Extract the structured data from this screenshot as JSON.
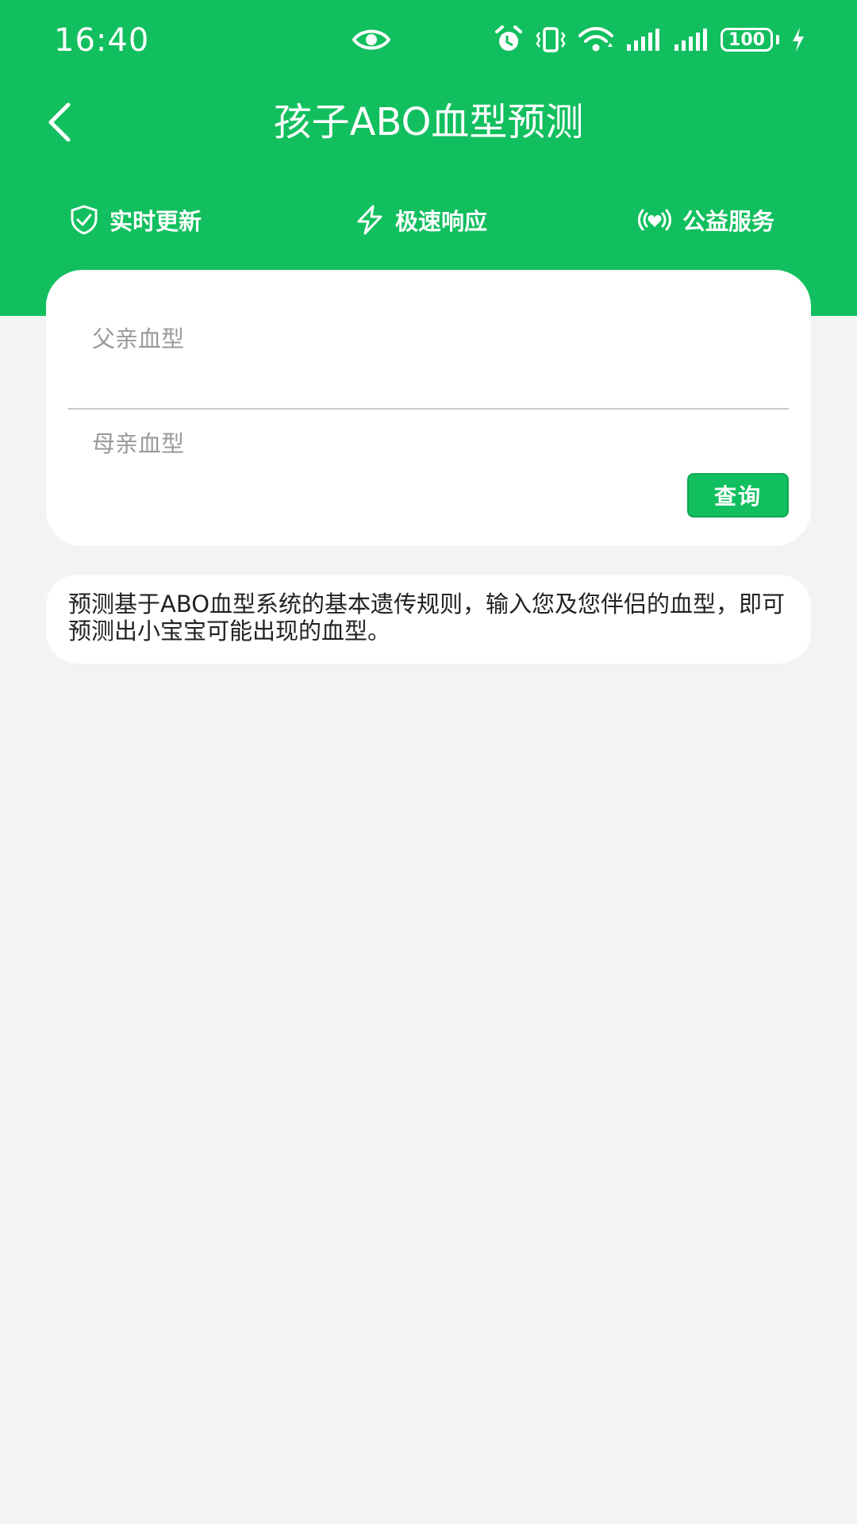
{
  "status_bar": {
    "time": "16:40",
    "battery": "100",
    "icons": [
      "eye-icon",
      "alarm-icon",
      "vibrate-icon",
      "wifi-icon",
      "signal-icon",
      "signal-icon",
      "battery-icon",
      "charging-icon"
    ]
  },
  "header": {
    "title": "孩子ABO血型预测",
    "back_icon": "chevron-left-icon"
  },
  "features": [
    {
      "label": "实时更新",
      "icon": "shield-check-icon"
    },
    {
      "label": "极速响应",
      "icon": "lightning-icon"
    },
    {
      "label": "公益服务",
      "icon": "heart-signal-icon"
    }
  ],
  "form": {
    "father_placeholder": "父亲血型",
    "mother_placeholder": "母亲血型",
    "query_label": "查询"
  },
  "info": {
    "text": "预测基于ABO血型系统的基本遗传规则，输入您及您伴侣的血型，即可预测出小宝宝可能出现的血型。"
  },
  "colors": {
    "primary": "#12bf5e",
    "background": "#f2f3f5",
    "card": "#ffffff",
    "placeholder": "#9a9a9a",
    "text": "#222222"
  }
}
